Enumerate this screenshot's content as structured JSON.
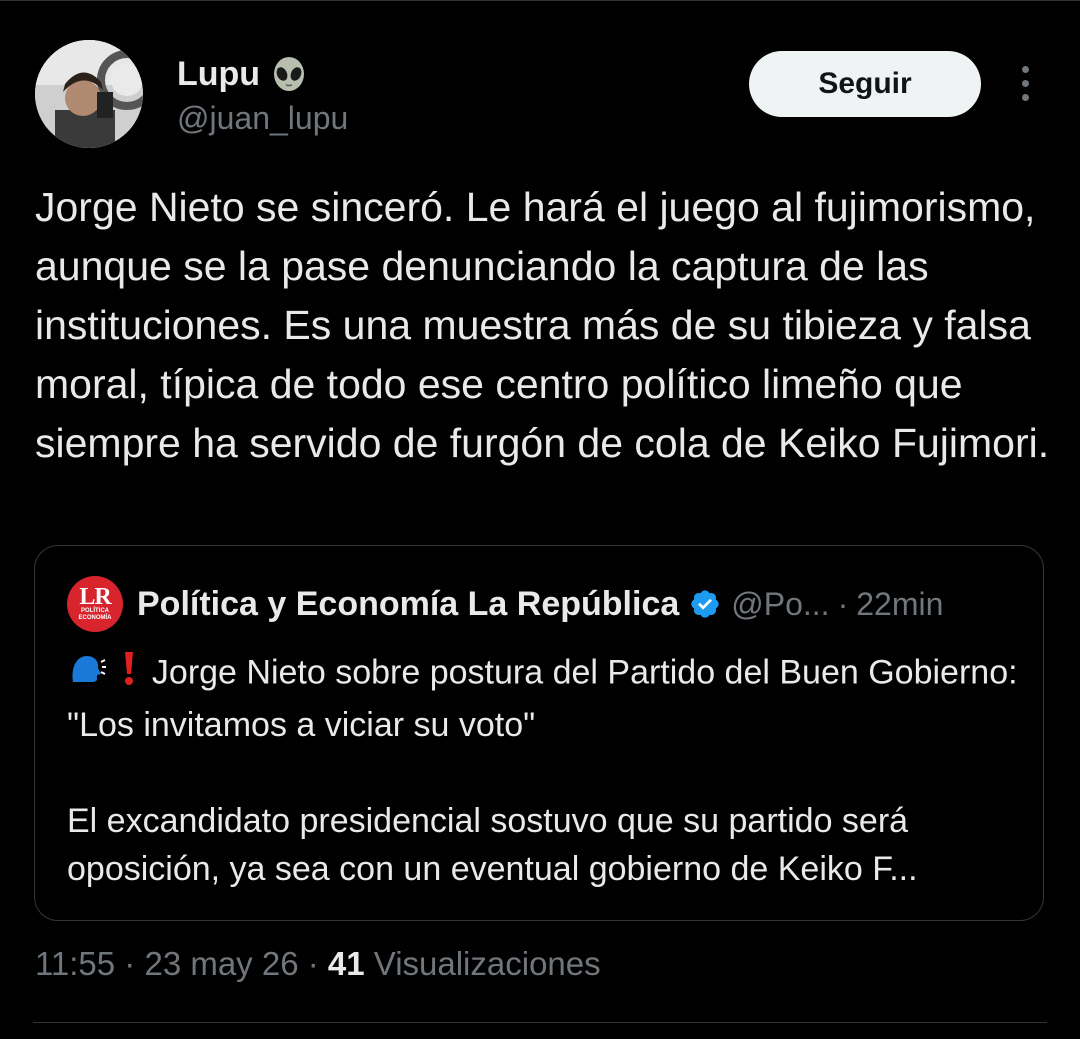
{
  "author": {
    "display_name": "Lupu",
    "name_emoji": "alien-icon",
    "handle": "@juan_lupu"
  },
  "follow_button": {
    "label": "Seguir"
  },
  "more_menu": {
    "icon": "more-vertical-icon"
  },
  "tweet": {
    "text": "Jorge Nieto se sinceró. Le hará el juego al fujimorismo, aunque se la pase denunciando la captura de las instituciones. Es una muestra más de su tibieza y falsa moral, típica de todo ese centro político limeño que siempre ha servido de furgón de cola de Keiko Fujimori."
  },
  "quote": {
    "logo": {
      "initials": "LR",
      "subtitle_1": "POLÍTICA",
      "subtitle_2": "ECONOMÍA"
    },
    "name": "Política y Economía La República",
    "verified_icon": "verified-badge-icon",
    "handle": "@Po...",
    "separator": "·",
    "time": "22min",
    "headline": "Jorge Nieto sobre postura del Partido del Buen Gobierno: \"Los invitamos a viciar su voto\"",
    "body": "El excandidato presidencial sostuvo que su partido será oposición, ya sea con un eventual gobierno de Keiko F..."
  },
  "meta": {
    "time": "11:55",
    "sep1": " · ",
    "date": "23 may 26",
    "sep2": " · ",
    "views_count": "41",
    "views_label": " Visualizaciones"
  },
  "colors": {
    "background": "#000000",
    "text": "#e7e9ea",
    "secondary": "#71767b",
    "border": "#333639",
    "verified": "#1d9bf0",
    "follow_bg": "#eff3f4"
  }
}
